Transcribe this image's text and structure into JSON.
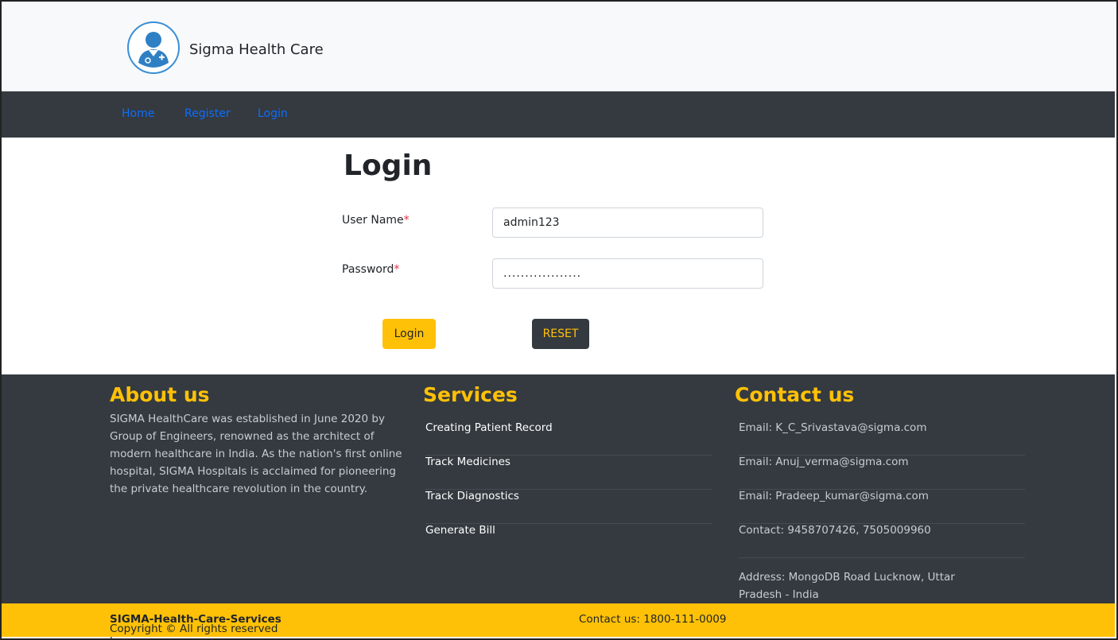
{
  "header": {
    "brand": "Sigma Health Care",
    "logo_icon": "doctor-avatar-icon"
  },
  "nav": {
    "items": [
      "Home",
      "Register",
      "Login"
    ]
  },
  "login": {
    "title": "Login",
    "username_label": "User Name",
    "username_value": "admin123",
    "password_label": "Password",
    "password_value": "..................",
    "required_marker": "*",
    "login_button": "Login",
    "reset_button": "RESET"
  },
  "footer": {
    "about": {
      "title": "About us",
      "text": "SIGMA HealthCare was established in June 2020 by Group of Engineers, renowned as the architect of modern healthcare in India. As the nation's first online hospital, SIGMA Hospitals is acclaimed for pioneering the private healthcare revolution in the country."
    },
    "services": {
      "title": "Services",
      "items": [
        "Creating Patient Record",
        "Track Medicines",
        "Track Diagnostics",
        "Generate Bill"
      ]
    },
    "contact": {
      "title": "Contact us",
      "items": [
        "Email: K_C_Srivastava@sigma.com",
        "Email: Anuj_verma@sigma.com",
        "Email: Pradeep_kumar@sigma.com",
        "Contact: 9458707426, 7505009960",
        "Address: MongoDB Road Lucknow, Uttar Pradesh - India"
      ]
    }
  },
  "copyright": {
    "prefix": "Copyright © All rights reserved by ",
    "company": "SIGMA-Health-Care-Services",
    "contact": "Contact us: 1800-111-0009"
  },
  "colors": {
    "accent": "#ffc107",
    "dark": "#343a40",
    "link": "#0d6efd",
    "required": "#dc3545"
  }
}
